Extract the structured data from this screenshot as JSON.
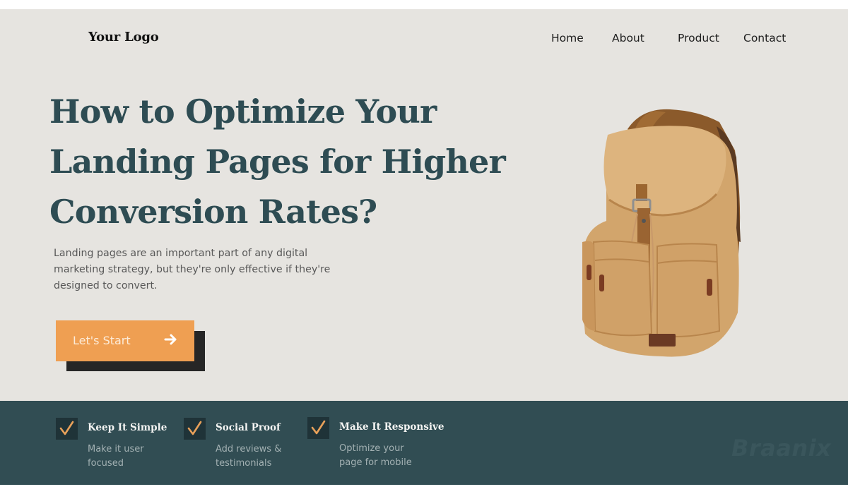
{
  "header": {
    "logo": "Your Logo",
    "nav": [
      {
        "label": "Home"
      },
      {
        "label": "About"
      },
      {
        "label": "Product"
      },
      {
        "label": "Contact"
      }
    ]
  },
  "hero": {
    "headline_lines": [
      "How to Optimize Your",
      "Landing Pages for Higher",
      "Conversion Rates?"
    ],
    "lead_lines": [
      "Landing pages are an important part of any digital",
      "marketing strategy, but they're only effective if they're",
      "designed to convert."
    ],
    "cta": {
      "label": "Let's Start",
      "icon": "arrow-right-icon"
    },
    "image": {
      "subject": "tan canvas drawstring backpack"
    }
  },
  "features": [
    {
      "icon": "checkmark-icon",
      "title": "Keep It Simple",
      "desc_lines": [
        "Make it user",
        "focused"
      ]
    },
    {
      "icon": "checkmark-icon",
      "title": "Social Proof",
      "desc_lines": [
        "Add reviews &",
        "testimonials"
      ]
    },
    {
      "icon": "checkmark-icon",
      "title": "Make It Responsive",
      "desc_lines": [
        "Optimize your",
        "page for mobile"
      ]
    }
  ],
  "watermark": "Braanix",
  "colors": {
    "background": "#E6E4E0",
    "headline": "#2E4C53",
    "accent": "#EF9F52",
    "band": "#314D53",
    "check_box": "#1F3338"
  }
}
